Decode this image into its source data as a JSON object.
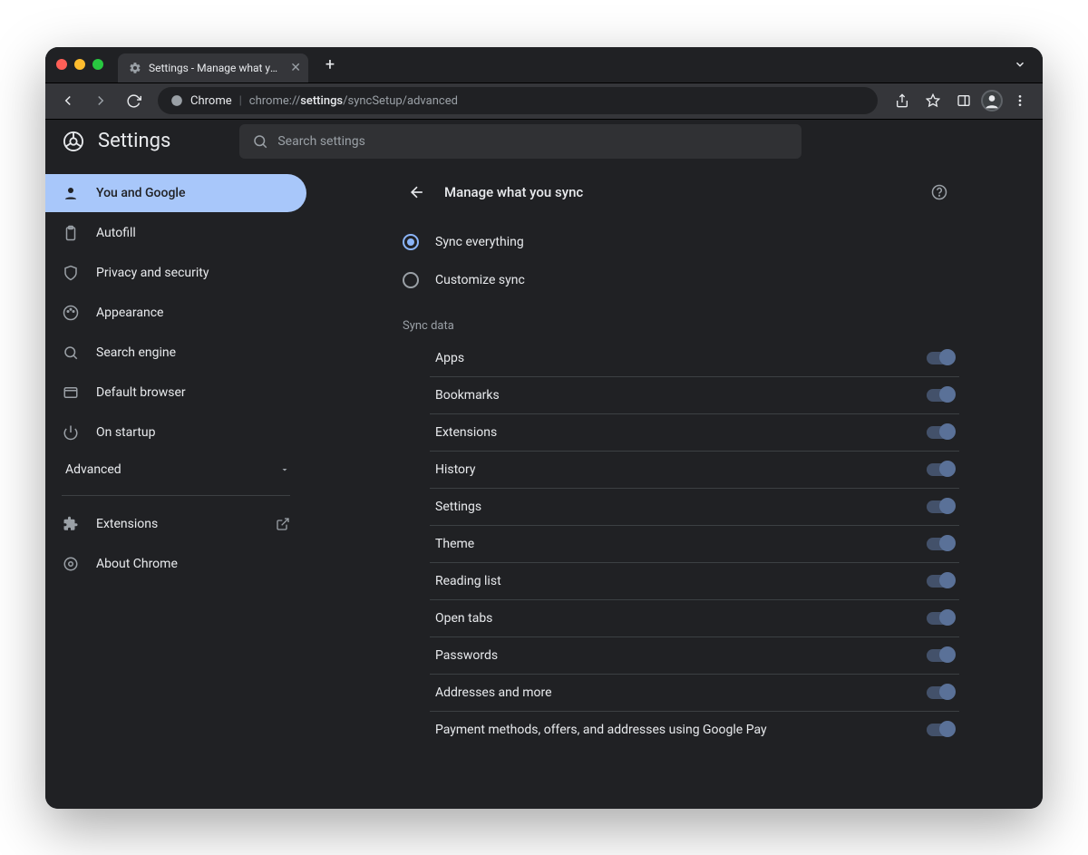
{
  "titlebar": {
    "tab_title": "Settings - Manage what you sy"
  },
  "toolbar": {
    "url_host_label": "Chrome",
    "url_prefix": "chrome://",
    "url_bold": "settings",
    "url_suffix": "/syncSetup/advanced"
  },
  "header": {
    "app_title": "Settings",
    "search_placeholder": "Search settings"
  },
  "sidebar": {
    "items": [
      {
        "label": "You and Google",
        "icon": "person",
        "active": true
      },
      {
        "label": "Autofill",
        "icon": "clipboard"
      },
      {
        "label": "Privacy and security",
        "icon": "shield"
      },
      {
        "label": "Appearance",
        "icon": "palette"
      },
      {
        "label": "Search engine",
        "icon": "search"
      },
      {
        "label": "Default browser",
        "icon": "window"
      },
      {
        "label": "On startup",
        "icon": "power"
      }
    ],
    "advanced_label": "Advanced",
    "extensions_label": "Extensions",
    "about_label": "About Chrome"
  },
  "panel": {
    "title": "Manage what you sync",
    "radio_sync_everything": "Sync everything",
    "radio_customize": "Customize sync",
    "section_label": "Sync data",
    "data_items": [
      "Apps",
      "Bookmarks",
      "Extensions",
      "History",
      "Settings",
      "Theme",
      "Reading list",
      "Open tabs",
      "Passwords",
      "Addresses and more",
      "Payment methods, offers, and addresses using Google Pay"
    ]
  }
}
